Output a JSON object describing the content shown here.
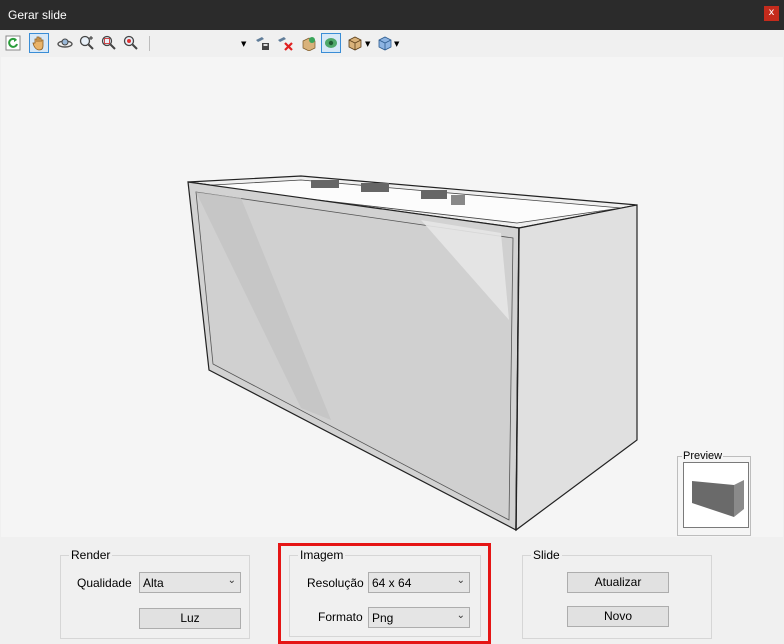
{
  "window": {
    "title": "Gerar slide",
    "close_label": "x"
  },
  "toolbar": {
    "tools": [
      "refresh-icon",
      "pan-hand-icon",
      "orbit-icon",
      "zoom-in-icon",
      "zoom-window-icon",
      "zoom-extents-icon",
      "camera-save-icon",
      "camera-delete-icon",
      "export-icon",
      "view-mode-icon",
      "box-view-icon",
      "cube-view-icon"
    ]
  },
  "preview": {
    "label": "Preview"
  },
  "render": {
    "label": "Render",
    "quality_label": "Qualidade",
    "quality_value": "Alta",
    "light_button": "Luz"
  },
  "image": {
    "label": "Imagem",
    "resolution_label": "Resolução",
    "resolution_value": "64 x 64",
    "format_label": "Formato",
    "format_value": "Png"
  },
  "slide": {
    "label": "Slide",
    "update_button": "Atualizar",
    "new_button": "Novo"
  },
  "colors": {
    "titlebar": "#2b2b2b",
    "close": "#c42b1c",
    "highlight": "#e51515",
    "active_tool": "#3a8dd6"
  }
}
